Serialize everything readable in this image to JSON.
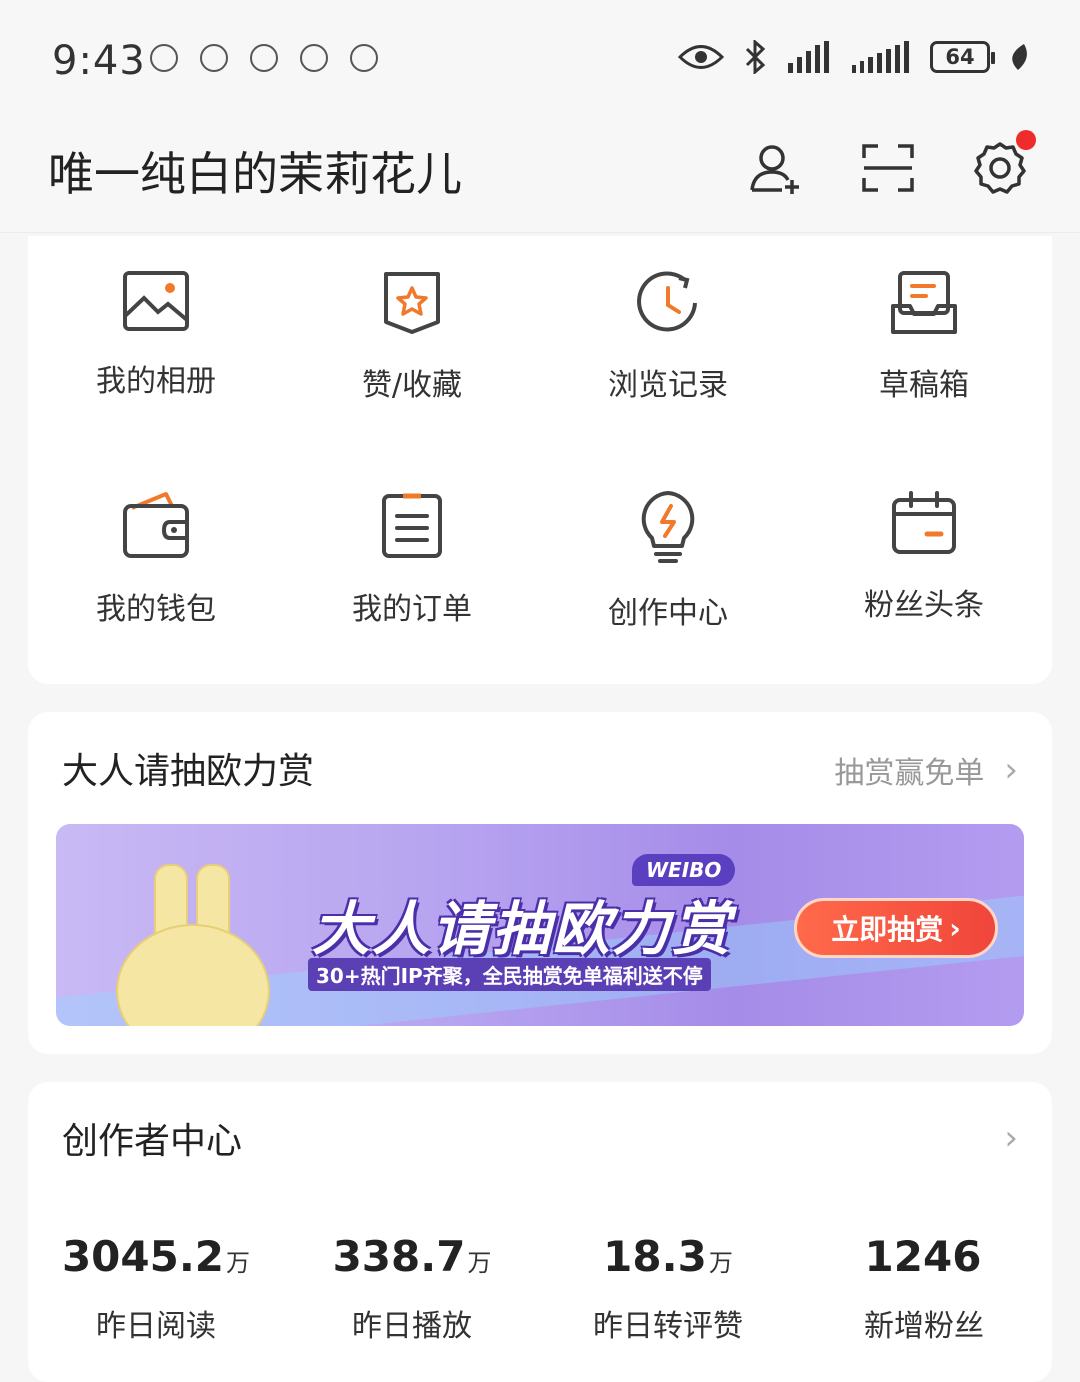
{
  "status_bar": {
    "time": "9:43",
    "battery": "64",
    "notif_icons": [
      "notification-icon",
      "notification-icon",
      "notification-icon",
      "notification-icon",
      "notification-icon"
    ]
  },
  "header": {
    "username": "唯一纯白的茉莉花儿"
  },
  "grid": {
    "items": [
      {
        "label": "我的相册",
        "icon": "photo-album-icon"
      },
      {
        "label": "赞/收藏",
        "icon": "favorites-icon"
      },
      {
        "label": "浏览记录",
        "icon": "history-icon"
      },
      {
        "label": "草稿箱",
        "icon": "drafts-icon"
      },
      {
        "label": "我的钱包",
        "icon": "wallet-icon"
      },
      {
        "label": "我的订单",
        "icon": "orders-icon"
      },
      {
        "label": "创作中心",
        "icon": "lightbulb-icon"
      },
      {
        "label": "粉丝头条",
        "icon": "calendar-icon"
      }
    ]
  },
  "promo": {
    "title": "大人请抽欧力赏",
    "link": "抽赏赢免单",
    "banner": {
      "tag": "WEIBO",
      "title": "大人请抽欧力赏",
      "subtitle": "30+热门IP齐聚，全民抽赏免单福利送不停",
      "cta": "立即抽赏"
    }
  },
  "creator": {
    "title": "创作者中心",
    "stats": [
      {
        "value": "3045.2",
        "unit": "万",
        "label": "昨日阅读"
      },
      {
        "value": "338.7",
        "unit": "万",
        "label": "昨日播放"
      },
      {
        "value": "18.3",
        "unit": "万",
        "label": "昨日转评赞"
      },
      {
        "value": "1246",
        "unit": "",
        "label": "新增粉丝"
      }
    ]
  },
  "colors": {
    "accent": "#f07a2a",
    "icon_stroke": "#444444",
    "badge": "#f02b2b"
  }
}
